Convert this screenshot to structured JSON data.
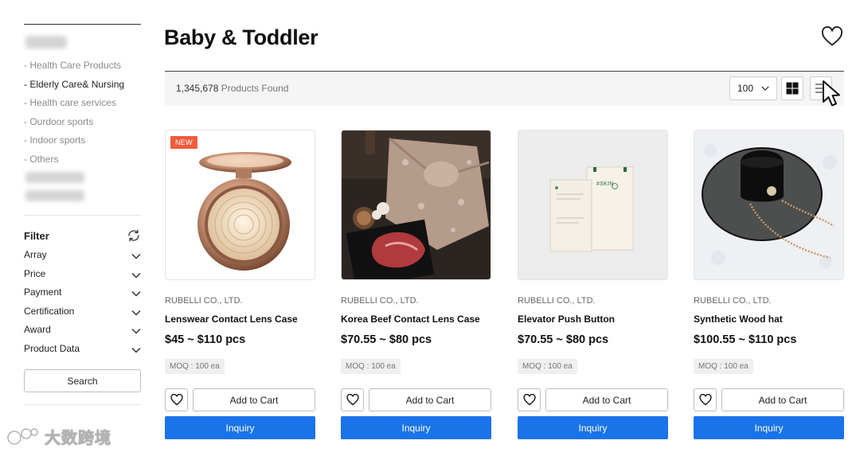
{
  "sidebar": {
    "categories": [
      {
        "label": "- Health Care Products"
      },
      {
        "label": "- Elderly Care& Nursing"
      },
      {
        "label": "- Health care services"
      },
      {
        "label": "- Ourdoor sports"
      },
      {
        "label": "- Indoor sports"
      },
      {
        "label": "- Others"
      }
    ],
    "filter_title": "Filter",
    "filters": [
      {
        "label": "Array"
      },
      {
        "label": "Price"
      },
      {
        "label": "Payment"
      },
      {
        "label": "Certification"
      },
      {
        "label": "Award"
      },
      {
        "label": "Product Data"
      }
    ],
    "search_label": "Search"
  },
  "header": {
    "title": "Baby & Toddler"
  },
  "toolbar": {
    "found_count": "1,345,678",
    "found_label": " Products Found",
    "per_page": "100"
  },
  "products": [
    {
      "badge": "NEW",
      "company": "RUBELLI CO., LTD.",
      "name": "Lenswear Contact Lens Case",
      "price": "$45 ~ $110 pcs",
      "moq": "MOQ : 100 ea",
      "cart_label": "Add to Cart",
      "inquiry_label": "Inquiry"
    },
    {
      "company": "RUBELLI CO., LTD.",
      "name": "Korea Beef Contact Lens Case",
      "price": "$70.55 ~ $80 pcs",
      "moq": "MOQ : 100 ea",
      "cart_label": "Add to Cart",
      "inquiry_label": "Inquiry"
    },
    {
      "company": "RUBELLI CO., LTD.",
      "name": "Elevator Push Button",
      "price": "$70.55 ~ $80 pcs",
      "moq": "MOQ : 100 ea",
      "cart_label": "Add to Cart",
      "inquiry_label": "Inquiry",
      "package_label": "#SKIN"
    },
    {
      "company": "RUBELLI CO., LTD.",
      "name": "Synthetic Wood hat",
      "price": "$100.55 ~ $110 pcs",
      "moq": "MOQ : 100 ea",
      "cart_label": "Add to Cart",
      "inquiry_label": "Inquiry"
    }
  ],
  "watermark": {
    "text": "大数跨境"
  },
  "colors": {
    "accent": "#1a73e8",
    "badge": "#ef5b3d",
    "toolbar_bg": "#f5f5f5"
  },
  "icons": [
    "heart-icon",
    "refresh-icon",
    "chevron-down-icon",
    "grid-view-icon",
    "list-view-icon",
    "cursor-icon"
  ]
}
